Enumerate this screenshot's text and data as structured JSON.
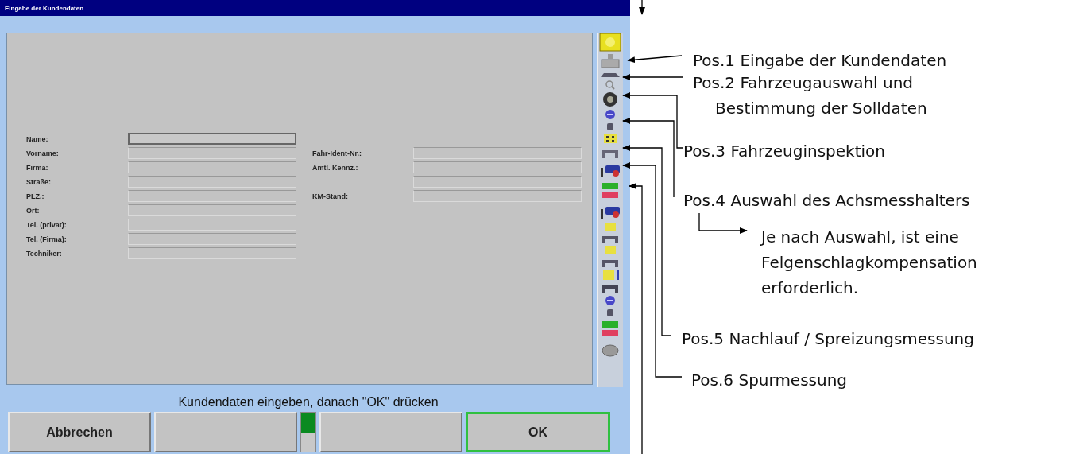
{
  "window": {
    "title": "Eingabe der Kundendaten"
  },
  "form": {
    "left": [
      {
        "label": "Name:",
        "focused": true
      },
      {
        "label": "Vorname:",
        "focused": false
      },
      {
        "label": "Firma:",
        "focused": false
      },
      {
        "label": "Straße:",
        "focused": false
      },
      {
        "label": "PLZ.:",
        "focused": false
      },
      {
        "label": "Ort:",
        "focused": false
      },
      {
        "label": "Tel. (privat):",
        "focused": false
      },
      {
        "label": "Tel. (Firma):",
        "focused": false
      },
      {
        "label": "Techniker:",
        "focused": false
      }
    ],
    "right": [
      {
        "label": "Fahr-Ident-Nr.:",
        "focused": false
      },
      {
        "label": "Amtl. Kennz.:",
        "focused": false
      },
      {
        "focused": false
      },
      {
        "label": "KM-Stand:",
        "focused": false
      }
    ]
  },
  "status": "Kundendaten eingeben, danach \"OK\" drücken",
  "buttons": [
    {
      "kind": "button",
      "label": "Abbrechen",
      "default": false
    },
    {
      "kind": "button",
      "default": false
    },
    {
      "kind": "indicator",
      "level": 0.5
    },
    {
      "kind": "button",
      "default": false
    },
    {
      "kind": "button",
      "label": "OK",
      "default": true
    }
  ],
  "annotations": [
    {
      "lines": [
        "Pos.1 Eingabe der Kundendaten"
      ]
    },
    {
      "lines": [
        "Pos.2 Fahrzeugauswahl und",
        "Bestimmung der Solldaten"
      ]
    },
    {
      "lines": [
        "Pos.3 Fahrzeuginspektion"
      ]
    },
    {
      "lines": [
        "Pos.4 Auswahl des Achsmesshalters"
      ]
    },
    {
      "lines": [
        "Je nach Auswahl, ist eine",
        "Felgenschlagkompensation",
        "erforderlich."
      ]
    },
    {
      "lines": [
        "Pos.5 Nachlauf / Spreizungsmessung"
      ]
    },
    {
      "lines": [
        "Pos.6 Spurmessung"
      ]
    }
  ]
}
